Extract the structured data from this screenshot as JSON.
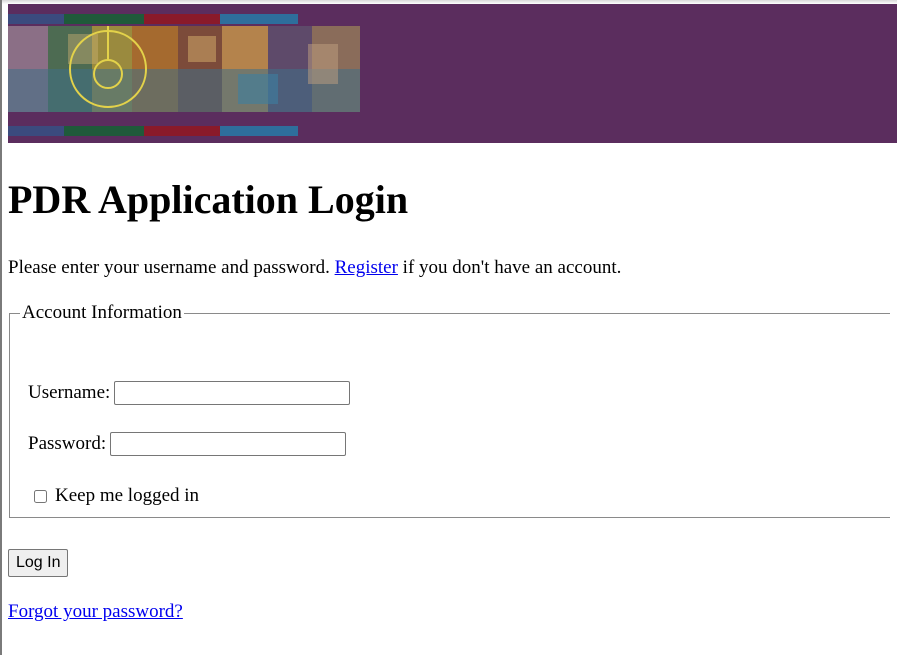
{
  "header": {
    "banner_image": "pdr-collage-banner",
    "background_color": "#5b2d5e",
    "stripe_colors": [
      "#3b4b7e",
      "#1f5a3a",
      "#8a1a2a",
      "#2e6e9c"
    ]
  },
  "page": {
    "title": "PDR Application Login",
    "intro_before": "Please enter your username and password. ",
    "register_link": "Register",
    "intro_after": " if you don't have an account."
  },
  "account_info": {
    "legend": "Account Information",
    "username_label": "Username:",
    "username_value": "",
    "password_label": "Password:",
    "password_value": "",
    "keep_logged_in_label": "Keep me logged in",
    "keep_logged_in_checked": false
  },
  "actions": {
    "login_button": "Log In",
    "forgot_password_link": "Forgot your password?"
  },
  "colors": {
    "link": "#0000ee"
  }
}
